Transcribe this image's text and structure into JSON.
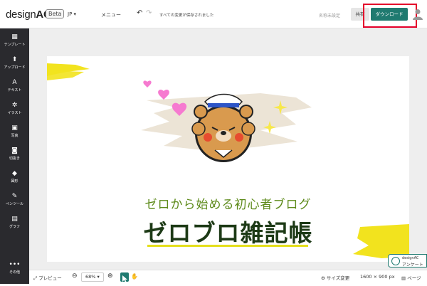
{
  "header": {
    "logo_design": "design",
    "logo_ac": "AC",
    "beta": "Beta",
    "language": "JP ▾",
    "menu": "メニュー",
    "undo_icon": "undo-icon",
    "redo_icon": "redo-icon",
    "saved_status": "すべての変更が保存されました",
    "unnamed": "名称未設定",
    "share": "共有",
    "download": "ダウンロード"
  },
  "sidebar": {
    "items": [
      {
        "label": "テンプレート",
        "icon": "template-icon",
        "glyph": "▦"
      },
      {
        "label": "アップロード",
        "icon": "upload-icon",
        "glyph": "⬆"
      },
      {
        "label": "テキスト",
        "icon": "text-icon",
        "glyph": "A"
      },
      {
        "label": "イラスト",
        "icon": "illustration-icon",
        "glyph": "✲"
      },
      {
        "label": "写真",
        "icon": "photo-icon",
        "glyph": "▣"
      },
      {
        "label": "切抜き",
        "icon": "cutout-icon",
        "glyph": "◙"
      },
      {
        "label": "図形",
        "icon": "shape-icon",
        "glyph": "◆"
      },
      {
        "label": "ペンツール",
        "icon": "pen-tool-icon",
        "glyph": "✎"
      },
      {
        "label": "グラフ",
        "icon": "graph-icon",
        "glyph": "▤"
      },
      {
        "label": "その他",
        "icon": "more-icon",
        "glyph": "•••"
      }
    ]
  },
  "canvas": {
    "subtitle": "ゼロから始める初心者ブログ",
    "title": "ゼロブロ雑記帳"
  },
  "footer": {
    "preview": "プレビュー",
    "zoom": "68%",
    "size_change": "サイズ変更",
    "dimensions": "1600 × 900 px",
    "pages": "ページ"
  },
  "survey": {
    "line1": "designAC",
    "line2": "アンケート"
  },
  "colors": {
    "accent": "#1f7a70",
    "sidebar": "#2a2a2e",
    "highlight": "#e4002b",
    "title": "#1d3a16",
    "subtitle": "#5d8a1a",
    "yellow": "#f2e31e"
  }
}
